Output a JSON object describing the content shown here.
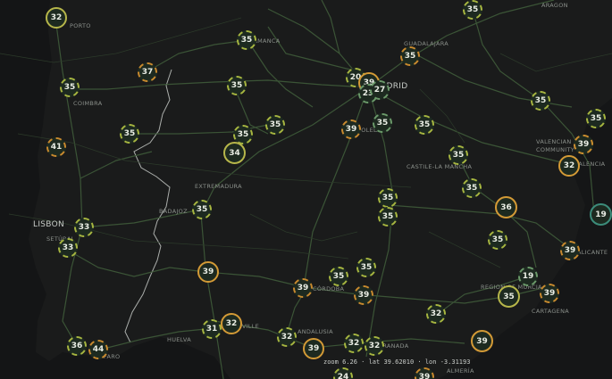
{
  "map": {
    "style": "dark",
    "colors": {
      "land": "#1a1b1b",
      "sea": "#141516",
      "roads": "#3f5b3a",
      "border": "#cfd3cf"
    },
    "place_labels": [
      "ARAGON",
      "SALAMANCA",
      "GUADALAJARA",
      "MADRID",
      "COIMBRA",
      "VALENCIAN COMMUNITY",
      "VALENCIA",
      "CASTILE-LA MANCHA",
      "EXTREMADURA",
      "BADAJOZ",
      "LISBON",
      "SETÚBAL",
      "REGION OF MURCIA",
      "CARTAGENA",
      "CÓRDOBA",
      "ANDALUSIA",
      "HUELVA",
      "GRANADA",
      "ALMERÍA",
      "ALICANTE",
      "FARO",
      "PORTO",
      "TOLEDO",
      "SEVILLE"
    ],
    "markers": [
      {
        "label": "32",
        "style": "solid-yg"
      },
      {
        "label": "35",
        "style": "dash-yg"
      },
      {
        "label": "35",
        "style": "dash-yg"
      },
      {
        "label": "35",
        "style": "dash-or"
      },
      {
        "label": "37",
        "style": "dash-or"
      },
      {
        "label": "35",
        "style": "dash-yg"
      },
      {
        "label": "35",
        "style": "dash-yg"
      },
      {
        "label": "20",
        "style": "dash-yg"
      },
      {
        "label": "39",
        "style": "solid-or"
      },
      {
        "label": "23",
        "style": "dash-gr"
      },
      {
        "label": "27",
        "style": "dash-gr"
      },
      {
        "label": "35",
        "style": "dash-yg"
      },
      {
        "label": "35",
        "style": "dash-yg"
      },
      {
        "label": "35",
        "style": "dash-yg"
      },
      {
        "label": "39",
        "style": "dash-or"
      },
      {
        "label": "35",
        "style": "dash-gr"
      },
      {
        "label": "35",
        "style": "dash-yg"
      },
      {
        "label": "35",
        "style": "dash-yg"
      },
      {
        "label": "41",
        "style": "dash-or"
      },
      {
        "label": "35",
        "style": "dash-yg"
      },
      {
        "label": "35",
        "style": "dash-yg"
      },
      {
        "label": "34",
        "style": "solid-yg"
      },
      {
        "label": "35",
        "style": "dash-yg"
      },
      {
        "label": "35",
        "style": "dash-yg"
      },
      {
        "label": "39",
        "style": "dash-or"
      },
      {
        "label": "32",
        "style": "solid-or"
      },
      {
        "label": "35",
        "style": "dash-yg"
      },
      {
        "label": "35",
        "style": "dash-yg"
      },
      {
        "label": "35",
        "style": "dash-yg"
      },
      {
        "label": "36",
        "style": "solid-or"
      },
      {
        "label": "19",
        "style": "teal"
      },
      {
        "label": "33",
        "style": "dash-yg"
      },
      {
        "label": "33",
        "style": "dash-yg"
      },
      {
        "label": "35",
        "style": "dash-yg"
      },
      {
        "label": "39",
        "style": "dash-or"
      },
      {
        "label": "39",
        "style": "solid-or"
      },
      {
        "label": "35",
        "style": "dash-yg"
      },
      {
        "label": "35",
        "style": "dash-yg"
      },
      {
        "label": "39",
        "style": "dash-or"
      },
      {
        "label": "39",
        "style": "dash-or"
      },
      {
        "label": "19",
        "style": "dash-gr"
      },
      {
        "label": "35",
        "style": "solid-yg"
      },
      {
        "label": "39",
        "style": "dash-or"
      },
      {
        "label": "32",
        "style": "dash-yg"
      },
      {
        "label": "31",
        "style": "dash-yg"
      },
      {
        "label": "32",
        "style": "solid-or"
      },
      {
        "label": "32",
        "style": "dash-yg"
      },
      {
        "label": "39",
        "style": "solid-or"
      },
      {
        "label": "32",
        "style": "dash-yg"
      },
      {
        "label": "32",
        "style": "dash-yg"
      },
      {
        "label": "39",
        "style": "solid-or"
      },
      {
        "label": "36",
        "style": "dash-yg"
      },
      {
        "label": "44",
        "style": "dash-or"
      },
      {
        "label": "24",
        "style": "dash-yg"
      },
      {
        "label": "39",
        "style": "dash-or"
      }
    ],
    "readout": {
      "zoom_label": "zoom",
      "zoom": "6.26",
      "lat_label": "lat",
      "lat": "39.62010",
      "lon_label": "lon",
      "lon": "-3.31193"
    }
  }
}
